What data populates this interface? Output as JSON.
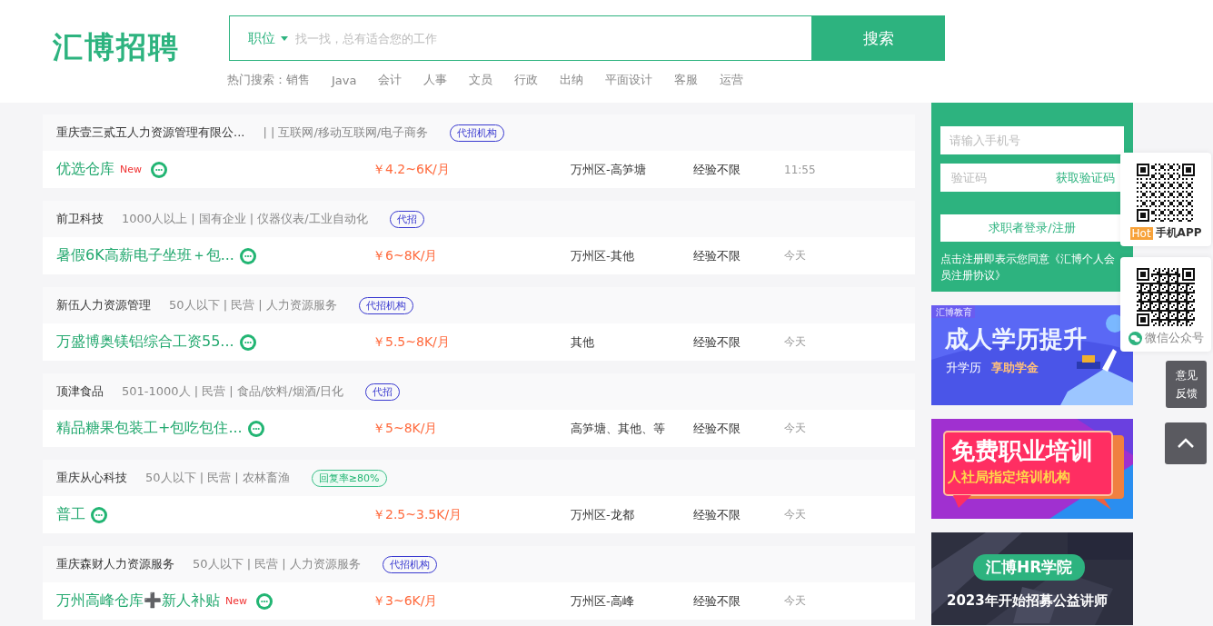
{
  "header": {
    "logo": "汇博招聘",
    "search": {
      "category": "职位",
      "placeholder": "找一找，总有适合您的工作",
      "button": "搜索"
    },
    "hot_label": "热门搜索：",
    "hot": [
      "销售",
      "Java",
      "会计",
      "人事",
      "文员",
      "行政",
      "出纳",
      "平面设计",
      "客服",
      "运营"
    ]
  },
  "jobs": [
    {
      "company": "重庆壹三贰五人力资源管理有限公...",
      "info": "| | 互联网/移动互联网/电子商务",
      "tag": {
        "kind": "agency",
        "label": "代招机构"
      },
      "title": "优选仓库",
      "new_label": "New",
      "salary": "￥4.2~6K/月",
      "location": "万州区-高笋塘",
      "experience": "经验不限",
      "time": "11:55"
    },
    {
      "company": "前卫科技",
      "info": "1000人以上 | 国有企业 | 仪器仪表/工业自动化",
      "tag": {
        "kind": "agency",
        "label": "代招"
      },
      "title": "暑假6K高薪电子坐班＋包...",
      "salary": "￥6~8K/月",
      "location": "万州区-其他",
      "experience": "经验不限",
      "time": "今天"
    },
    {
      "company": "新伍人力资源管理",
      "info": "50人以下 | 民营 | 人力资源服务",
      "tag": {
        "kind": "agency",
        "label": "代招机构"
      },
      "title": "万盛博奥镁铝综合工资55...",
      "salary": "￥5.5~8K/月",
      "location": "其他",
      "experience": "经验不限",
      "time": "今天"
    },
    {
      "company": "顶津食品",
      "info": "501-1000人 | 民营 | 食品/饮料/烟酒/日化",
      "tag": {
        "kind": "agency",
        "label": "代招"
      },
      "title": "精品糖果包装工+包吃包住...",
      "salary": "￥5~8K/月",
      "location": "高笋塘、其他、等",
      "experience": "经验不限",
      "time": "今天"
    },
    {
      "company": "重庆从心科技",
      "info": "50人以下 | 民营 | 农林畜渔",
      "tag": {
        "kind": "reply",
        "label": "回复率≥80%"
      },
      "title": "普工",
      "salary": "￥2.5~3.5K/月",
      "location": "万州区-龙都",
      "experience": "经验不限",
      "time": "今天"
    },
    {
      "company": "重庆森财人力资源服务",
      "info": "50人以下 | 民营 | 人力资源服务",
      "tag": {
        "kind": "agency",
        "label": "代招机构"
      },
      "title": "万州高峰仓库➕新人补贴",
      "new_label": "New",
      "salary": "￥3~6K/月",
      "location": "万州区-高峰",
      "experience": "经验不限",
      "time": "今天"
    }
  ],
  "login": {
    "phone_placeholder": "请输入手机号",
    "code_placeholder": "验证码",
    "get_code": "获取验证码",
    "button": "求职者登录/注册",
    "agreement": "点击注册即表示您同意《汇博个人会员注册协议》"
  },
  "banners": [
    {
      "kind": "education",
      "brand": "汇博教育",
      "title": "成人学历提升",
      "subtitle": "升学历",
      "highlight": "享助学金"
    },
    {
      "kind": "training",
      "title": "免费职业培训",
      "subtitle": "人社局指定培训机构"
    },
    {
      "kind": "academy",
      "title": "汇博HR学院",
      "subtitle": "2023年开始招募公益讲师"
    }
  ],
  "floating": {
    "qr_cards": [
      {
        "kind": "app",
        "badge": "Hot",
        "label": "手机APP"
      },
      {
        "kind": "wechat",
        "label": "微信公众号"
      }
    ],
    "feedback": "意见反馈"
  }
}
